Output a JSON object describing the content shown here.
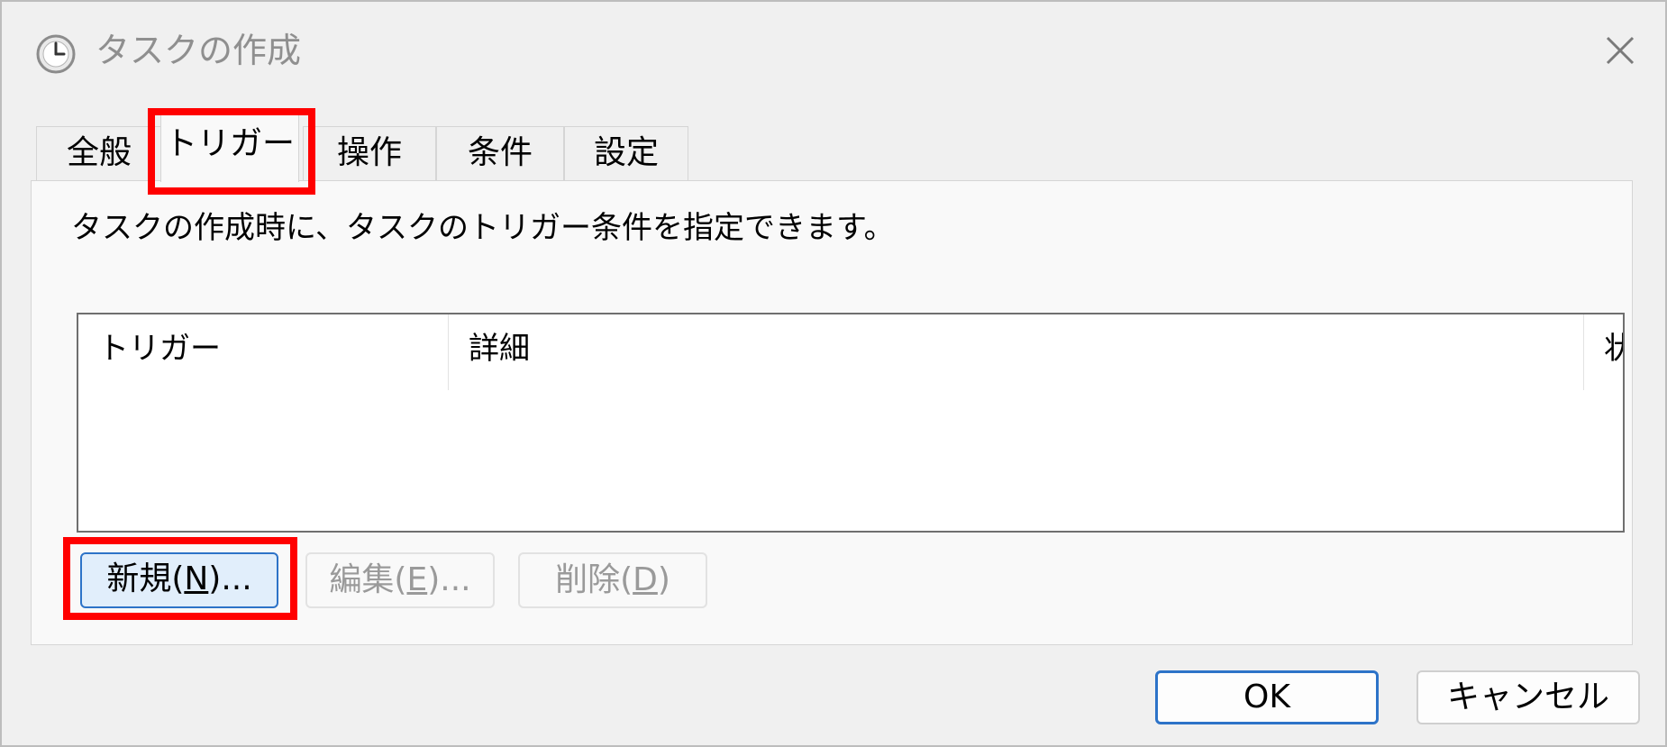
{
  "window": {
    "title": "タスクの作成",
    "icon": "clock-icon",
    "close_icon": "close-icon"
  },
  "tabs": [
    {
      "label": "全般",
      "active": false
    },
    {
      "label": "トリガー",
      "active": true
    },
    {
      "label": "操作",
      "active": false
    },
    {
      "label": "条件",
      "active": false
    },
    {
      "label": "設定",
      "active": false
    }
  ],
  "trigger_panel": {
    "description": "タスクの作成時に、タスクのトリガー条件を指定できます。",
    "columns": [
      "トリガー",
      "詳細",
      "状"
    ],
    "rows": []
  },
  "actions": {
    "new": {
      "label": "新規(",
      "mnemonic": "N",
      "suffix": ")...",
      "enabled": true
    },
    "edit": {
      "label": "編集(",
      "mnemonic": "E",
      "suffix": ")...",
      "enabled": false
    },
    "delete": {
      "label": "削除(",
      "mnemonic": "D",
      "suffix": ")",
      "enabled": false
    }
  },
  "footer": {
    "ok_label": "OK",
    "cancel_label": "キャンセル"
  },
  "colors": {
    "highlight": "#ff0000",
    "accent": "#2d73c8",
    "button_hover_bg": "#e1eefb"
  }
}
